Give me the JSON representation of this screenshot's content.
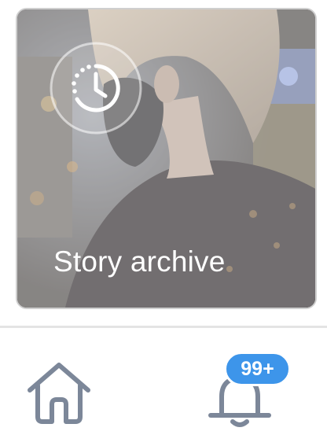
{
  "story_card": {
    "label": "Story archive",
    "icon": "archive-clock-icon"
  },
  "bottom_nav": {
    "home": {
      "icon": "home-icon"
    },
    "notifications": {
      "icon": "bell-icon",
      "badge": "99+"
    }
  },
  "colors": {
    "icon_stroke": "#7c8799",
    "badge_bg": "#3d95ea",
    "label": "#ffffff"
  }
}
